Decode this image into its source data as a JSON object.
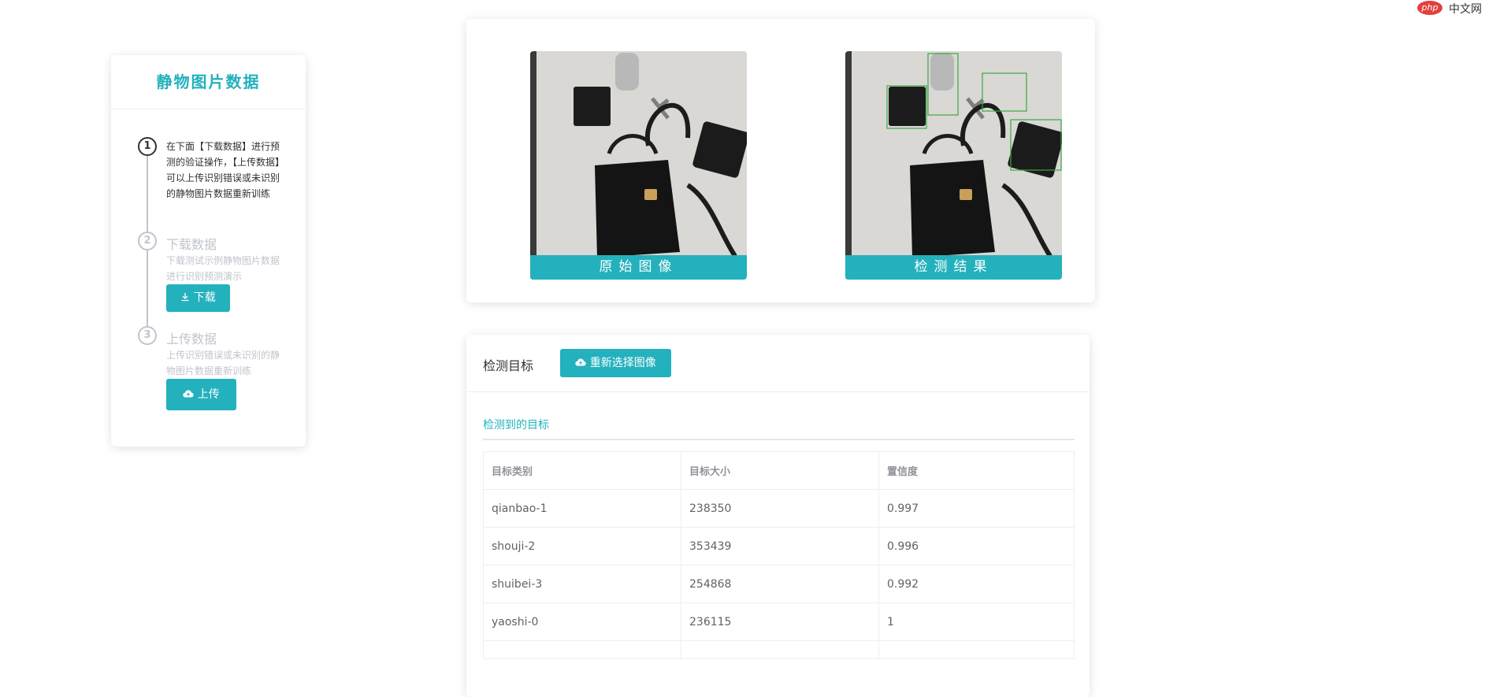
{
  "watermark": {
    "logo_text": "php",
    "site_text": "中文网"
  },
  "steps_panel": {
    "title": "静物图片数据",
    "steps": [
      {
        "number": "1",
        "title": "",
        "description": "在下面【下载数据】进行预测的验证操作，【上传数据】可以上传识别错误或未识别的静物图片数据重新训练"
      },
      {
        "number": "2",
        "title": "下载数据",
        "description": "下载测试示例静物图片数据进行识别预测演示",
        "button_label": "下载",
        "button_icon": "download-icon"
      },
      {
        "number": "3",
        "title": "上传数据",
        "description": "上传识别错误或未识别的静物图片数据重新训练",
        "button_label": "上传",
        "button_icon": "cloud-upload-icon"
      }
    ]
  },
  "images_panel": {
    "original_caption": "原始图像",
    "result_caption": "检测结果"
  },
  "result_panel": {
    "title": "检测目标",
    "reselect_button": "重新选择图像",
    "tab_label": "检测到的目标",
    "columns": [
      "目标类别",
      "目标大小",
      "置信度"
    ],
    "rows": [
      [
        "qianbao-1",
        "238350",
        "0.997"
      ],
      [
        "shouji-2",
        "353439",
        "0.996"
      ],
      [
        "shuibei-3",
        "254868",
        "0.992"
      ],
      [
        "yaoshi-0",
        "236115",
        "1"
      ]
    ]
  },
  "colors": {
    "accent": "#23b1bd",
    "box": "#3aa845"
  }
}
